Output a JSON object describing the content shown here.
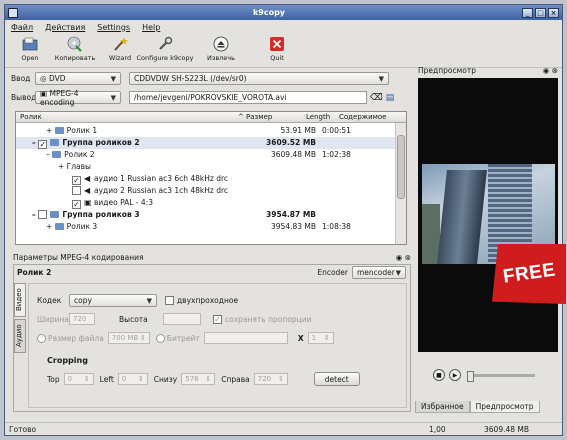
{
  "window": {
    "title": "k9copy"
  },
  "menu": [
    "Файл",
    "Действия",
    "Settings",
    "Help"
  ],
  "toolbar": [
    {
      "label": "Open",
      "icon": "open-icon"
    },
    {
      "label": "Копировать",
      "icon": "copy-icon"
    },
    {
      "label": "Wizard",
      "icon": "wizard-icon"
    },
    {
      "label": "Configure k9copy",
      "icon": "configure-icon"
    },
    {
      "label": "Извлечь",
      "icon": "eject-icon"
    },
    {
      "label": "Quit",
      "icon": "quit-icon"
    }
  ],
  "input": {
    "label": "Ввод",
    "source": "DVD",
    "device": "CDDVDW SH-S223L (/dev/sr0)"
  },
  "output": {
    "label": "Вывод",
    "format": "MPEG-4 encoding",
    "path": "/home/jevgeni/POKROVSKIE_VOROTA.avi"
  },
  "tree": {
    "headers": {
      "name": "Ролик",
      "size": "Размер",
      "length": "Length",
      "content": "Содержимое"
    },
    "rows": [
      {
        "name": "Ролик 1",
        "size": "53.91 MB",
        "length": "0:00:51"
      },
      {
        "name": "Группа роликов 2",
        "size": "3609.52 MB",
        "length": ""
      },
      {
        "name": "Ролик 2",
        "size": "3609.48 MB",
        "length": "1:02:38"
      },
      {
        "name": "Главы",
        "size": "",
        "length": ""
      },
      {
        "name": "аудио 1 Russian ac3 6ch 48kHz drc",
        "size": "",
        "length": ""
      },
      {
        "name": "аудио 2 Russian ac3 1ch 48kHz drc",
        "size": "",
        "length": ""
      },
      {
        "name": "видео PAL - 4:3",
        "size": "",
        "length": ""
      },
      {
        "name": "Группа роликов 3",
        "size": "3954.87 MB",
        "length": ""
      },
      {
        "name": "Ролик 3",
        "size": "3954.83 MB",
        "length": "1:08:38"
      }
    ]
  },
  "params": {
    "header": "Параметры MPEG-4 кодирования",
    "title": "Ролик 2",
    "encoder_label": "Encoder",
    "encoder_value": "mencoder",
    "tabs": [
      "Видео",
      "Аудио"
    ],
    "codec_label": "Кодек",
    "codec_value": "copy",
    "twopass": "двухпроходное",
    "width_label": "Ширина",
    "width_value": "720",
    "height_label": "Высота",
    "keep_ratio": "сохранять пропорции",
    "filesize_label": "Размер файла",
    "filesize_value": "700 MB",
    "bitrate_label": "Битрейт",
    "x_label": "X",
    "x_value": "1",
    "cropping": "Cropping",
    "top_label": "Top",
    "top_value": "0",
    "left_label": "Left",
    "left_value": "0",
    "bottom_label": "Снизу",
    "bottom_value": "576",
    "right_label": "Справа",
    "right_value": "720",
    "detect": "detect"
  },
  "preview": {
    "header": "Предпросмотр",
    "tabs": [
      "Избранное",
      "Предпросмотр"
    ]
  },
  "status": {
    "text": "Готово",
    "ratio": "1,00",
    "size": "3609.48 MB"
  },
  "badge": "FREE"
}
